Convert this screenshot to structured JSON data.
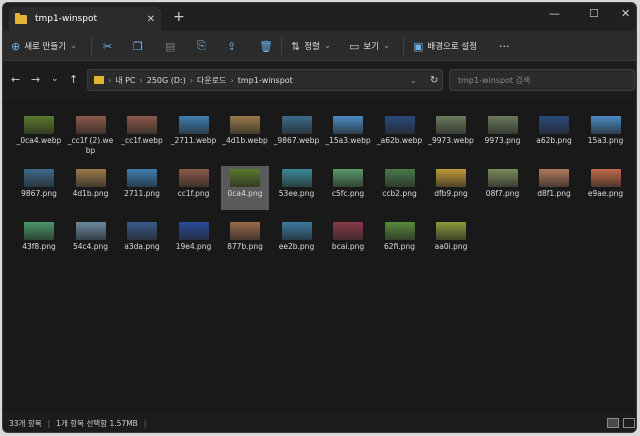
{
  "window": {
    "tab_title": "tmp1-winspot",
    "tab_close": "✕",
    "new_tab": "+",
    "minimize": "—",
    "maximize": "☐",
    "close": "✕"
  },
  "toolbar": {
    "new_label": "새로 만들기",
    "sort_label": "정렬",
    "view_label": "보기",
    "wallpaper_label": "배경으로 설정",
    "more": "···"
  },
  "address": {
    "crumbs": [
      "내 PC",
      "250G (D:)",
      "다운로드",
      "tmp1-winspot"
    ],
    "search_placeholder": "tmp1-winspot 검색"
  },
  "files": [
    {
      "name": "_0ca4.webp",
      "color": "#5b7a2e",
      "selected": false
    },
    {
      "name": "_cc1f (2).webp",
      "color": "#8a5a4a",
      "selected": false
    },
    {
      "name": "_cc1f.webp",
      "color": "#8a5a4a",
      "selected": false
    },
    {
      "name": "_2711.webp",
      "color": "#3f7fb3",
      "selected": false
    },
    {
      "name": "_4d1b.webp",
      "color": "#9a7a4a",
      "selected": false
    },
    {
      "name": "_9867.webp",
      "color": "#3d6a8a",
      "selected": false
    },
    {
      "name": "_15a3.webp",
      "color": "#4a8ac0",
      "selected": false
    },
    {
      "name": "_a62b.webp",
      "color": "#2a4a7a",
      "selected": false
    },
    {
      "name": "_9973.webp",
      "color": "#6a7a5a",
      "selected": false
    },
    {
      "name": "9973.png",
      "color": "#6a7a5a",
      "selected": false
    },
    {
      "name": "a62b.png",
      "color": "#2a4a7a",
      "selected": false
    },
    {
      "name": "15a3.png",
      "color": "#4a8ac0",
      "selected": false
    },
    {
      "name": "9867.png",
      "color": "#3d6a8a",
      "selected": false
    },
    {
      "name": "4d1b.png",
      "color": "#9a7a4a",
      "selected": false
    },
    {
      "name": "2711.png",
      "color": "#3f7fb3",
      "selected": false
    },
    {
      "name": "cc1f.png",
      "color": "#8a5a4a",
      "selected": false
    },
    {
      "name": "0ca4.png",
      "color": "#5b7a2e",
      "selected": true
    },
    {
      "name": "53ee.png",
      "color": "#3a8a9a",
      "selected": false
    },
    {
      "name": "c5fc.png",
      "color": "#5a9a6a",
      "selected": false
    },
    {
      "name": "ccb2.png",
      "color": "#4a7a4a",
      "selected": false
    },
    {
      "name": "dfb9.png",
      "color": "#c09a3a",
      "selected": false
    },
    {
      "name": "08f7.png",
      "color": "#7a8a5a",
      "selected": false
    },
    {
      "name": "d8f1.png",
      "color": "#b07a5a",
      "selected": false
    },
    {
      "name": "e9ae.png",
      "color": "#c06a4a",
      "selected": false
    },
    {
      "name": "43f8.png",
      "color": "#4a9a6a",
      "selected": false
    },
    {
      "name": "54c4.png",
      "color": "#6a8aa0",
      "selected": false
    },
    {
      "name": "a3da.png",
      "color": "#3a5a8a",
      "selected": false
    },
    {
      "name": "19e4.png",
      "color": "#2a4a9a",
      "selected": false
    },
    {
      "name": "877b.png",
      "color": "#9a6a4a",
      "selected": false
    },
    {
      "name": "ee2b.png",
      "color": "#3a7aa0",
      "selected": false
    },
    {
      "name": "bcai.png",
      "color": "#8a3a4a",
      "selected": false
    },
    {
      "name": "62fi.png",
      "color": "#5a8a3a",
      "selected": false
    },
    {
      "name": "aa0i.png",
      "color": "#8a9a3a",
      "selected": false
    }
  ],
  "status": {
    "count": "33개 항목",
    "divider": "|",
    "selected": "1개 항목 선택함 1.57MB",
    "divider2": "|"
  }
}
